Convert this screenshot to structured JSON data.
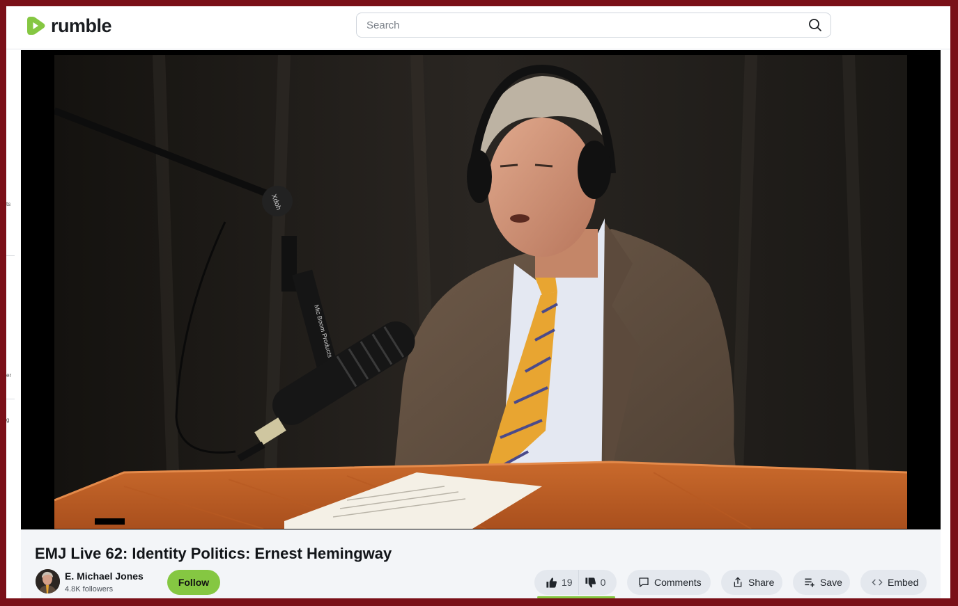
{
  "header": {
    "logo_text": "rumble",
    "search_placeholder": "Search",
    "brand_color": "#85c742"
  },
  "sidebar": {
    "partial_labels": [
      "ts",
      "er",
      "g"
    ]
  },
  "video": {
    "title": "EMJ Live 62: Identity Politics: Ernest Hemingway",
    "mic_text": "Xdoh",
    "boom_text": "Mic Boom Products"
  },
  "channel": {
    "name": "E. Michael Jones",
    "followers": "4.8K followers",
    "follow_label": "Follow"
  },
  "actions": {
    "likes": "19",
    "dislikes": "0",
    "comments_label": "Comments",
    "share_label": "Share",
    "save_label": "Save",
    "embed_label": "Embed"
  },
  "icons": [
    "play-logo-icon",
    "search-icon",
    "thumbs-up-icon",
    "thumbs-down-icon",
    "comment-icon",
    "share-icon",
    "save-playlist-icon",
    "embed-code-icon"
  ]
}
